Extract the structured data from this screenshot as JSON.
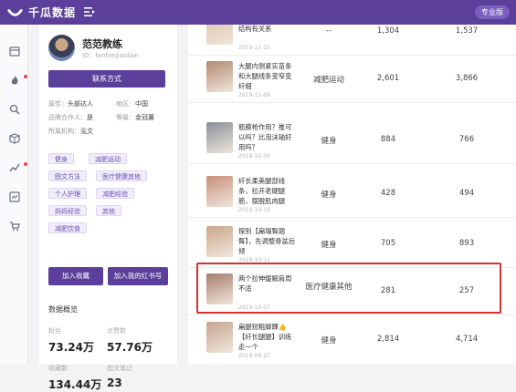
{
  "header": {
    "brand": "千瓜数据",
    "pro_label": "专业版"
  },
  "colors": {
    "brand": "#5b3f9a",
    "highlight": "#d6312e",
    "tag_text": "#6a50b0"
  },
  "rail": {
    "icons": [
      "calendar-icon",
      "fire-icon",
      "search-icon",
      "box-icon",
      "trend-icon",
      "analysis-icon",
      "cart-icon"
    ]
  },
  "profile": {
    "name": "范范教练",
    "id_text": "ID：fanfanjiaolian",
    "contact_label": "联系方式",
    "attr_label": "属性：",
    "attr_value": "头部达人",
    "region_label": "地区：",
    "region_value": "中国",
    "brand_label": "品牌合作人：",
    "brand_value": "是",
    "level_label": "等级：",
    "level_value": "金冠薯",
    "org_label": "所属机构：",
    "org_value": "泓文",
    "tags": [
      "健身",
      "减肥运动",
      "图文方法",
      "医疗健康其他",
      "个人护理",
      "减肥经验",
      "妈妈经验",
      "其他",
      "减肥饮食"
    ],
    "btn_collect": "加入收藏",
    "btn_redbook": "加入我的红书号",
    "section_title": "数据概览",
    "stats": [
      {
        "label": "粉丝",
        "value": "73.24万"
      },
      {
        "label": "点赞数",
        "value": "57.76万"
      },
      {
        "label": "收藏数",
        "value": "134.44万"
      },
      {
        "label": "图文笔记",
        "value": "23"
      }
    ]
  },
  "table": {
    "rows": [
      {
        "title": "大小脸和整个身体结构有关系",
        "date": "2019-11-15",
        "category": "--",
        "v1": "1,304",
        "v2": "1,537",
        "thumb": "#d9c0a8"
      },
      {
        "title": "大腿内侧紧实苗条和大腿线条变窄变纤细",
        "date": "2019-11-09",
        "category": "减肥运动",
        "v1": "2,601",
        "v2": "3,866",
        "thumb": "#b48a70"
      },
      {
        "title": "筋膜枪作用？推可以吗？比泡沫轴好用吗？",
        "date": "2019-10-30",
        "category": "健身",
        "v1": "884",
        "v2": "766",
        "thumb": "#8a8f99"
      },
      {
        "title": "纤长柔美腿部线条，拉开老硬腿筋，摆脱肌肉腿",
        "date": "2019-10-19",
        "category": "健身",
        "v1": "428",
        "v2": "494",
        "thumb": "#c88f7b"
      },
      {
        "title": "探别【扁塌臀翘臀】，先调整骨盆后倾",
        "date": "2019-10-11",
        "category": "健身",
        "v1": "705",
        "v2": "893",
        "thumb": "#cba78a"
      },
      {
        "title": "两个拉伸缓解肩周不适",
        "date": "2019-10-07",
        "category": "医疗健康其他",
        "v1": "281",
        "v2": "257",
        "thumb": "#a77d6b"
      },
      {
        "title": "扁腿短粗脚踝👍【纤长腿腿】训练走一个",
        "date": "2019-09-27",
        "category": "健身",
        "v1": "2,814",
        "v2": "4,714",
        "thumb": "#c6a58e"
      }
    ]
  }
}
